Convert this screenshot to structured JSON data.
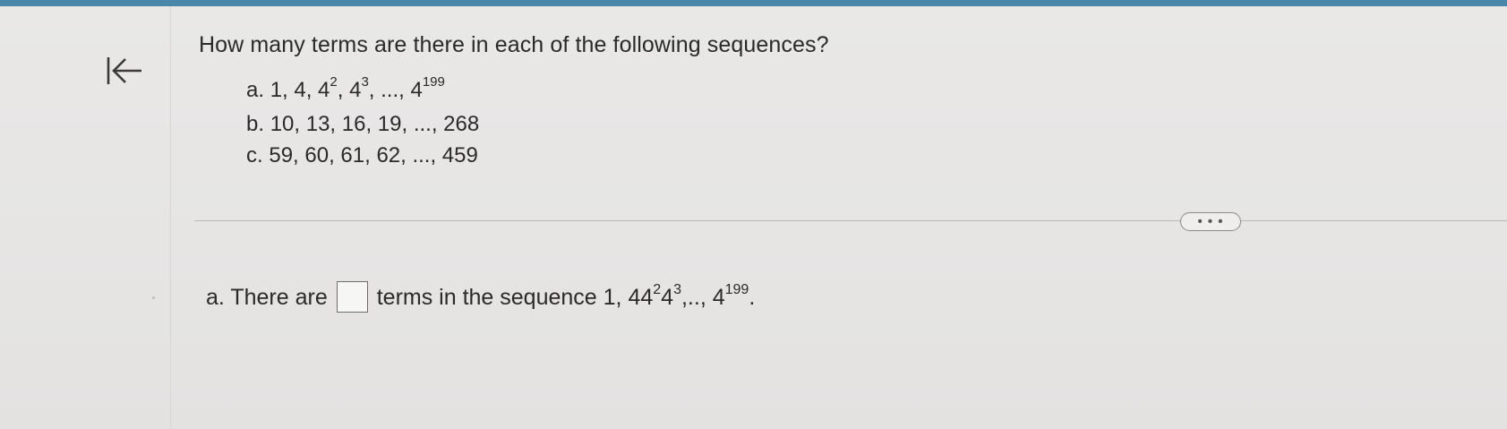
{
  "question": {
    "title": "How many terms are there in each of the following sequences?",
    "items": [
      {
        "label": "a.",
        "base_text": "1, 4, 4",
        "exp1": "2",
        "mid1": ", 4",
        "exp2": "3",
        "tail": ", ..., 4",
        "exp3": "199"
      },
      {
        "label": "b.",
        "text": "10, 13, 16, 19, ..., 268"
      },
      {
        "label": "c.",
        "text": "59, 60, 61, 62, ..., 459"
      }
    ]
  },
  "toolbar": {
    "more_label": "• • •"
  },
  "answer": {
    "prefix": "a. There are",
    "input_value": "",
    "suffix_start": "terms in the sequence 1, 4",
    "comma1": ",",
    "four2": "4",
    "exp2": "2",
    "comma2": ",",
    "four3": "4",
    "exp3": "3",
    "ellipsis": ",.., 4",
    "exp199": "199",
    "end": "."
  },
  "colors": {
    "accent_bar": "#4a86a8",
    "background": "#e7e6e5",
    "text": "#2a2a2a"
  },
  "icons": {
    "back": "back-to-start-arrow-icon"
  }
}
